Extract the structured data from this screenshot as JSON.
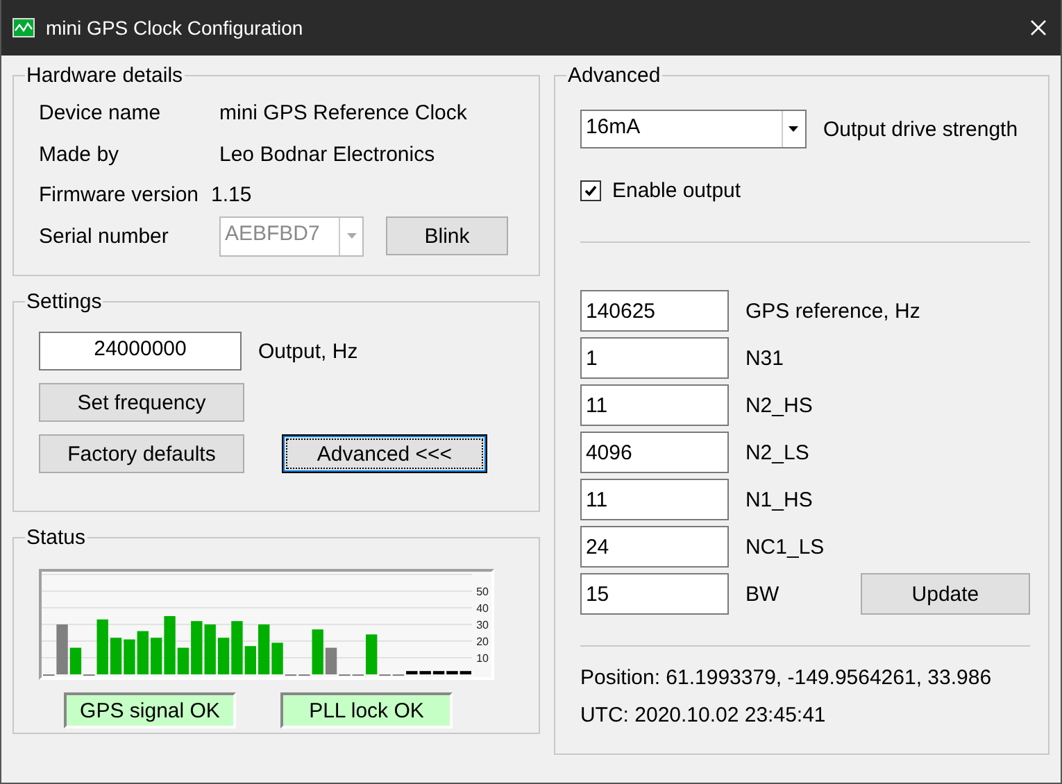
{
  "window": {
    "title": "mini GPS Clock Configuration"
  },
  "hardware": {
    "title": "Hardware details",
    "fields": [
      {
        "label": "Device name",
        "value": "mini GPS Reference Clock"
      },
      {
        "label": "Made by",
        "value": "Leo Bodnar Electronics"
      },
      {
        "label": "Firmware version",
        "value": "1.15"
      }
    ],
    "serial": {
      "label": "Serial number",
      "value": "AEBFBD7",
      "disabled": true
    },
    "blink_button": "Blink"
  },
  "settings": {
    "title": "Settings",
    "frequency": {
      "value": "24000000",
      "label": "Output, Hz"
    },
    "buttons": [
      {
        "label": "Set frequency",
        "focused": false
      },
      {
        "label": "Factory defaults",
        "focused": false
      },
      {
        "label": "Advanced <<<",
        "focused": true
      }
    ]
  },
  "status": {
    "title": "Status",
    "chart_data": {
      "type": "bar",
      "grid": true,
      "ylim": [
        0,
        60
      ],
      "yticks": [
        10,
        20,
        30,
        40,
        50
      ],
      "series": [
        {
          "color": "#00b000",
          "values": [
            null,
            null,
            16,
            null,
            33,
            22,
            21,
            26,
            22,
            35,
            16,
            32,
            30,
            22,
            32,
            17,
            30,
            19,
            null,
            null,
            27,
            null,
            null,
            null,
            24,
            null,
            null,
            null,
            null,
            null,
            null,
            null
          ]
        },
        {
          "color": "#808080",
          "values": [
            0,
            30,
            null,
            0,
            null,
            null,
            null,
            null,
            null,
            null,
            null,
            null,
            null,
            null,
            null,
            null,
            null,
            null,
            0,
            0,
            null,
            16,
            0,
            0,
            null,
            0,
            0,
            null,
            null,
            null,
            null,
            null
          ]
        },
        {
          "color": "#000000",
          "values": [
            null,
            null,
            null,
            null,
            null,
            null,
            null,
            null,
            null,
            null,
            null,
            null,
            null,
            null,
            null,
            null,
            null,
            null,
            null,
            null,
            null,
            null,
            null,
            null,
            null,
            null,
            null,
            2,
            2,
            2,
            2,
            2
          ]
        }
      ]
    },
    "indicators": [
      {
        "label": "GPS signal OK",
        "ok": true
      },
      {
        "label": "PLL lock OK",
        "ok": true
      }
    ]
  },
  "advanced": {
    "title": "Advanced",
    "drive": {
      "value": "16mA",
      "label": "Output drive strength"
    },
    "enable_output": {
      "label": "Enable output",
      "checked": true
    },
    "registers": [
      {
        "value": "140625",
        "label": "GPS reference, Hz"
      },
      {
        "value": "1",
        "label": "N31"
      },
      {
        "value": "11",
        "label": "N2_HS"
      },
      {
        "value": "4096",
        "label": "N2_LS"
      },
      {
        "value": "11",
        "label": "N1_HS"
      },
      {
        "value": "24",
        "label": "NC1_LS"
      },
      {
        "value": "15",
        "label": "BW"
      }
    ],
    "update_button": "Update",
    "position": "Position: 61.1993379, -149.9564261, 33.986",
    "utc": "UTC: 2020.10.02 23:45:41"
  }
}
